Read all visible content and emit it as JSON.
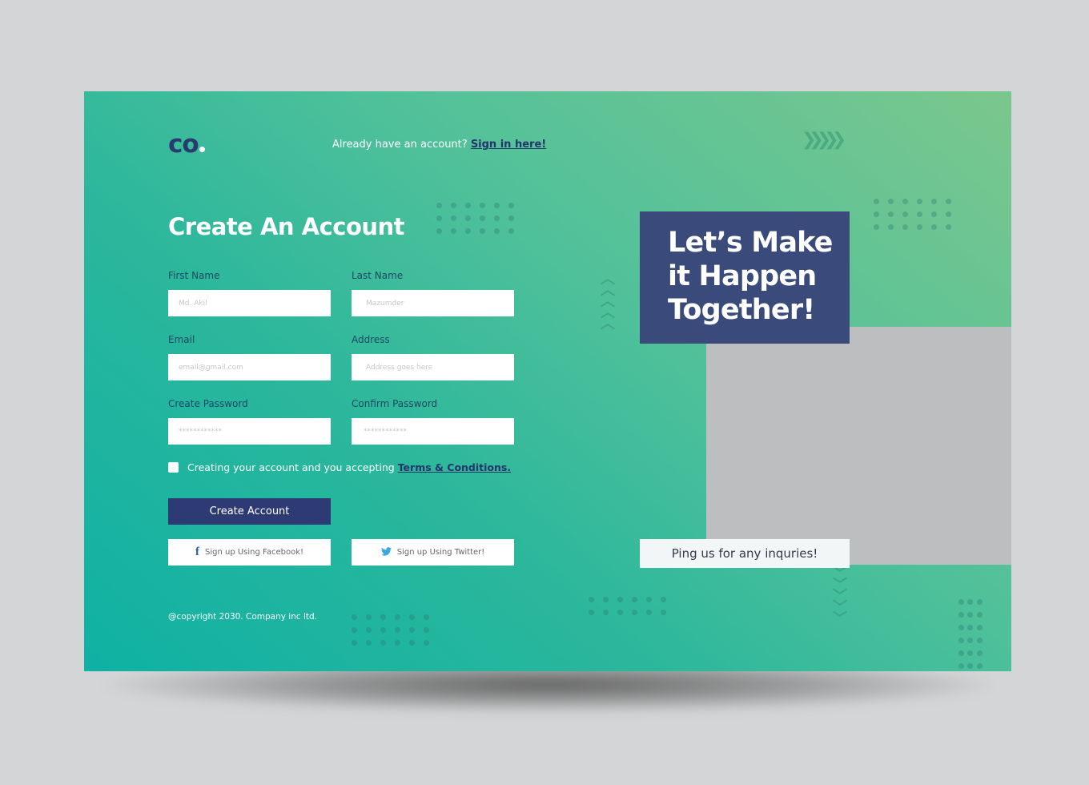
{
  "brand": {
    "logo": "co"
  },
  "header": {
    "signin_prompt": "Already have an account?",
    "signin_link": "Sign in here!"
  },
  "form": {
    "title": "Create An Account",
    "fields": [
      {
        "label": "First Name",
        "placeholder": "Md. Akil",
        "value": ""
      },
      {
        "label": "Last Name",
        "placeholder": "Mazumder",
        "value": ""
      },
      {
        "label": "Email",
        "placeholder": "email@gmail.com",
        "value": ""
      },
      {
        "label": "Address",
        "placeholder": "Address goes here",
        "value": ""
      },
      {
        "label": "Create Password",
        "placeholder": "************",
        "value": ""
      },
      {
        "label": "Confirm Password",
        "placeholder": "************",
        "value": ""
      }
    ],
    "terms_text": "Creating your account and you accepting",
    "terms_link": "Terms & Conditions.",
    "terms_checked": false,
    "submit_label": "Create Account",
    "facebook_label": "Sign up Using Facebook!",
    "twitter_label": "Sign up Using Twitter!",
    "icons": {
      "facebook": "f",
      "twitter": "🐦"
    }
  },
  "footer": {
    "copyright": "@copyright 2030. Company inc ltd."
  },
  "hero": {
    "headline": "Let’s Make it Happen Together!",
    "ping": "Ping us for any inquries!"
  },
  "colors": {
    "primary": "#2e3a73",
    "hero_box": "#3a4a7a",
    "gradient_start": "#0fb1a4",
    "gradient_end": "#7bc78d",
    "placeholder_block": "#bdbec0"
  }
}
